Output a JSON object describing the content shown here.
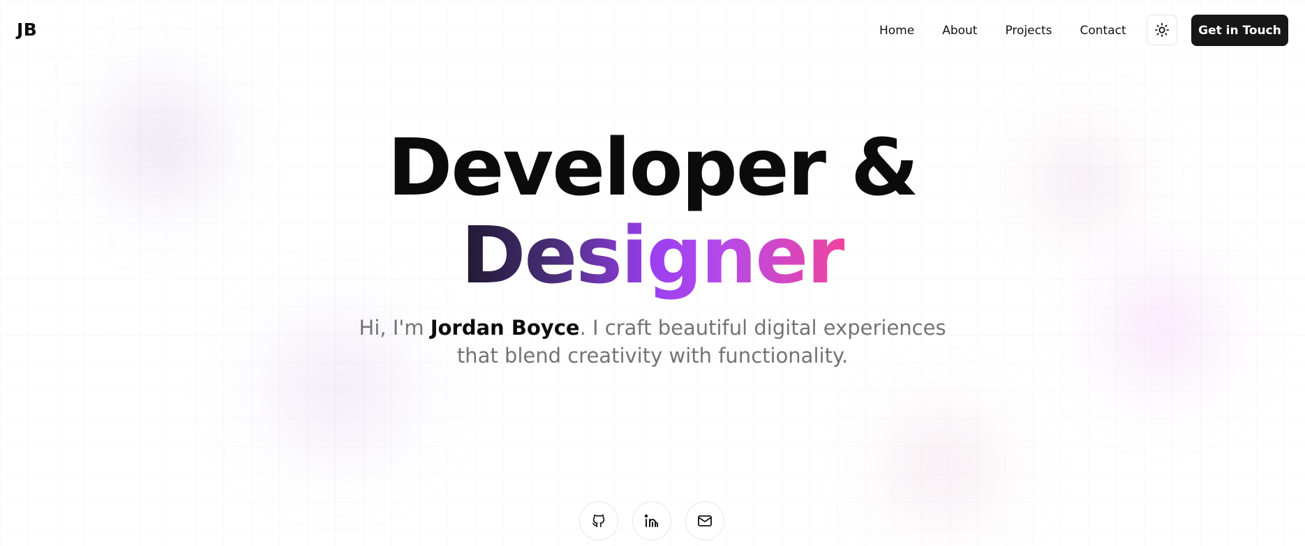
{
  "brand": {
    "logo": "JB"
  },
  "nav": {
    "links": [
      {
        "label": "Home"
      },
      {
        "label": "About"
      },
      {
        "label": "Projects"
      },
      {
        "label": "Contact"
      }
    ],
    "theme_toggle_icon": "sun-icon",
    "cta_label": "Get in Touch"
  },
  "hero": {
    "headline_line1": "Developer &",
    "headline_line2": "Designer",
    "subtitle_prefix": "Hi, I'm ",
    "subtitle_name": "Jordan Boyce",
    "subtitle_suffix": ". I craft beautiful digital experiences that blend creativity with functionality."
  },
  "socials": [
    {
      "icon": "github-icon"
    },
    {
      "icon": "linkedin-icon"
    },
    {
      "icon": "mail-icon"
    }
  ],
  "colors": {
    "text_primary": "#0b0b0b",
    "text_muted": "#737373",
    "cta_background": "#171717",
    "gradient_start": "#1f1830",
    "gradient_mid": "#9b3ff0",
    "gradient_end": "#f0449f"
  }
}
